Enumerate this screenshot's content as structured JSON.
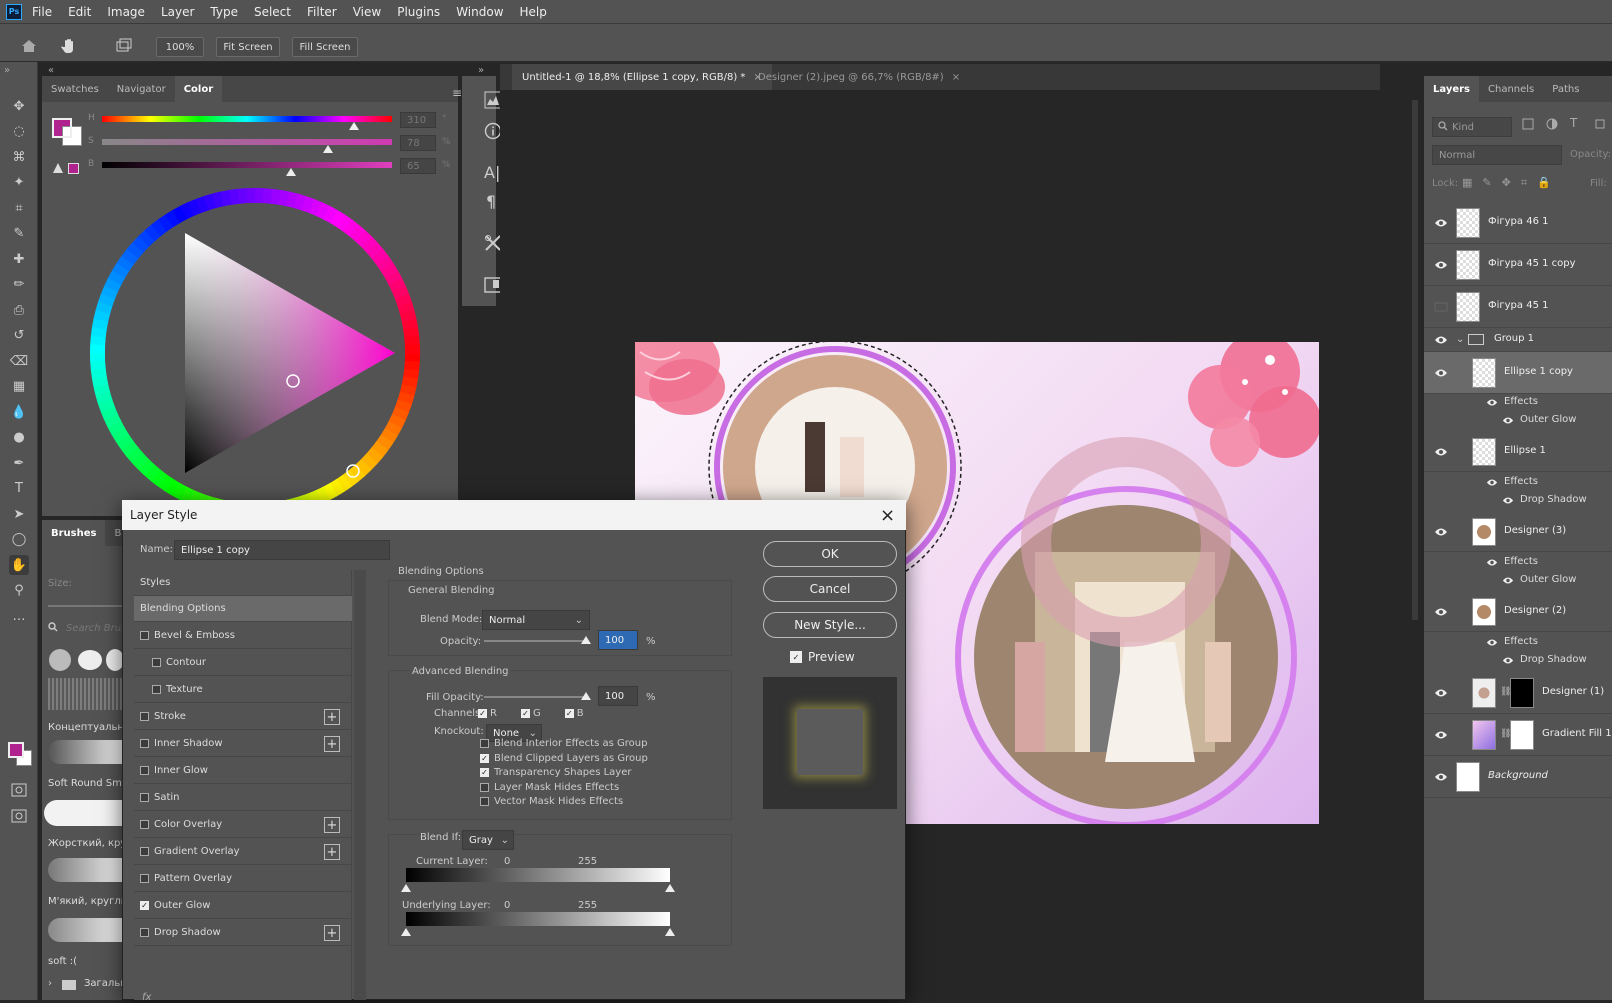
{
  "app": {
    "logo": "Ps"
  },
  "menu": [
    "File",
    "Edit",
    "Image",
    "Layer",
    "Type",
    "Select",
    "Filter",
    "View",
    "Plugins",
    "Window",
    "Help"
  ],
  "options": {
    "zoom": "100%",
    "fit_screen": "Fit Screen",
    "fill_screen": "Fill Screen"
  },
  "color_panel": {
    "tabs": [
      "Swatches",
      "Navigator",
      "Color"
    ],
    "active_tab": "Color",
    "sliders": [
      {
        "label": "H",
        "value": "310",
        "unit": "°",
        "position": 0.87
      },
      {
        "label": "S",
        "value": "78",
        "unit": "%",
        "position": 0.78
      },
      {
        "label": "B",
        "value": "65",
        "unit": "%",
        "position": 0.65
      }
    ],
    "foreground": "#b0238f",
    "background": "#ffffff"
  },
  "brushes": {
    "tabs": [
      "Brushes",
      "Brus"
    ],
    "size_label": "Size:",
    "search_placeholder": "Search Brush",
    "items": [
      "Концептуальні і",
      "Soft Round Smu",
      "Жорсткий, кругл",
      "М'який, круглий",
      "soft :("
    ],
    "folder": "Загальн"
  },
  "doc_tabs": [
    {
      "label": "Untitled-1 @ 18,8% (Ellipse 1 copy, RGB/8) *",
      "active": true
    },
    {
      "label": "Designer (2).jpeg @ 66,7% (RGB/8#)",
      "active": false
    }
  ],
  "layers_panel": {
    "tabs": [
      "Layers",
      "Channels",
      "Paths"
    ],
    "kind_placeholder": "Kind",
    "blend": "Normal",
    "opacity_label": "Opacity:",
    "lock_label": "Lock:",
    "fill_label": "Fill:",
    "layers": [
      {
        "name": "Фігура 46 1",
        "visible": true
      },
      {
        "name": "Фігура 45 1 copy",
        "visible": true
      },
      {
        "name": "Фігура 45 1",
        "visible": false
      },
      {
        "name": "Group 1",
        "visible": true,
        "group": true
      },
      {
        "name": "Ellipse 1 copy",
        "visible": true,
        "selected": true,
        "effects": [
          "Effects",
          "Outer Glow"
        ]
      },
      {
        "name": "Ellipse 1",
        "visible": true,
        "effects": [
          "Effects",
          "Drop Shadow"
        ]
      },
      {
        "name": "Designer (3)",
        "visible": true,
        "effects": [
          "Effects",
          "Outer Glow"
        ]
      },
      {
        "name": "Designer (2)",
        "visible": true,
        "effects": [
          "Effects",
          "Drop Shadow"
        ]
      },
      {
        "name": "Designer (1)",
        "visible": true
      },
      {
        "name": "Gradient Fill 1",
        "visible": true
      },
      {
        "name": "Background",
        "visible": true,
        "italic": true
      }
    ]
  },
  "dialog": {
    "title": "Layer Style",
    "name_label": "Name:",
    "name_value": "Ellipse 1 copy",
    "styles_header": "Styles",
    "styles": [
      {
        "label": "Blending Options",
        "selected": true
      },
      {
        "label": "Bevel & Emboss",
        "checked": false
      },
      {
        "label": "Contour",
        "checked": false,
        "indent": true
      },
      {
        "label": "Texture",
        "checked": false,
        "indent": true
      },
      {
        "label": "Stroke",
        "checked": false,
        "plus": true
      },
      {
        "label": "Inner Shadow",
        "checked": false,
        "plus": true
      },
      {
        "label": "Inner Glow",
        "checked": false
      },
      {
        "label": "Satin",
        "checked": false
      },
      {
        "label": "Color Overlay",
        "checked": false,
        "plus": true
      },
      {
        "label": "Gradient Overlay",
        "checked": false,
        "plus": true
      },
      {
        "label": "Pattern Overlay",
        "checked": false
      },
      {
        "label": "Outer Glow",
        "checked": true
      },
      {
        "label": "Drop Shadow",
        "checked": false,
        "plus": true
      }
    ],
    "blending_options": "Blending Options",
    "general_blending": "General Blending",
    "blend_mode_label": "Blend Mode:",
    "blend_mode": "Normal",
    "opacity_label": "Opacity:",
    "opacity": "100",
    "percent": "%",
    "advanced_blending": "Advanced Blending",
    "fill_opacity_label": "Fill Opacity:",
    "fill_opacity": "100",
    "channels_label": "Channels:",
    "channels": [
      "R",
      "G",
      "B"
    ],
    "knockout_label": "Knockout:",
    "knockout": "None",
    "adv_options": [
      {
        "label": "Blend Interior Effects as Group",
        "checked": false
      },
      {
        "label": "Blend Clipped Layers as Group",
        "checked": true
      },
      {
        "label": "Transparency Shapes Layer",
        "checked": true
      },
      {
        "label": "Layer Mask Hides Effects",
        "checked": false
      },
      {
        "label": "Vector Mask Hides Effects",
        "checked": false
      }
    ],
    "blend_if_label": "Blend If:",
    "blend_if": "Gray",
    "current_layer": "Current Layer:",
    "underlying_layer": "Underlying Layer:",
    "range_low": "0",
    "range_high": "255",
    "buttons": {
      "ok": "OK",
      "cancel": "Cancel",
      "new_style": "New Style...",
      "preview": "Preview"
    },
    "preview_checked": true
  }
}
